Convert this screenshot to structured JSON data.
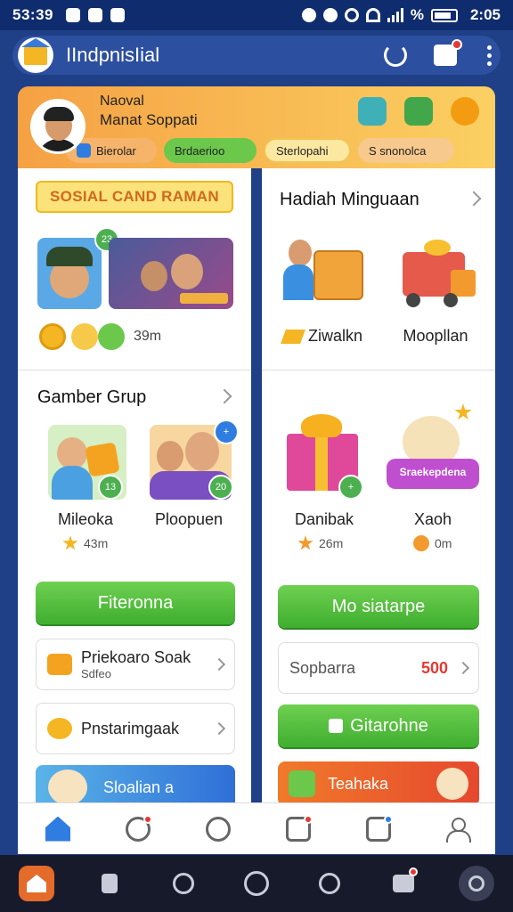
{
  "status_bar": {
    "time_left": "53:39",
    "time_right": "2:05",
    "percent_symbol": "%"
  },
  "app_bar": {
    "title": "IIndpnisIial"
  },
  "profile": {
    "name": "Naoval",
    "subtitle": "Manat Soppati",
    "chips": [
      "Bierolar",
      "Brdaerioo",
      "Sterlopahi",
      "S snonolca"
    ]
  },
  "left": {
    "banner": "SOSIAL CAND RAMAN",
    "top_badge": "23",
    "points": "39m",
    "group_title": "Gamber Grup",
    "items": [
      {
        "label": "Mileoka",
        "badge": "13",
        "points": "43m"
      },
      {
        "label": "Ploopuen",
        "badge": "20",
        "points": ""
      }
    ],
    "button": "Fiteronna",
    "rows": [
      {
        "title": "Priekoaro Soak",
        "sub": "Sdfeo"
      },
      {
        "title": "Pnstarimgaak",
        "sub": ""
      }
    ],
    "promo": "Sloalian a"
  },
  "right": {
    "title": "Hadiah Minguaan",
    "items_top": [
      {
        "label": "Ziwalkn"
      },
      {
        "label": "Moopllan"
      }
    ],
    "items_bottom": [
      {
        "label": "Danibak",
        "points": "26m"
      },
      {
        "label": "Xaoh",
        "points": "0m"
      }
    ],
    "sticker_text": "Sraekepdena",
    "button": "Mo siatarpe",
    "field": {
      "label": "Sopbarra",
      "value": "500"
    },
    "button2": "Gitarohne",
    "promo": "Teahaka"
  }
}
